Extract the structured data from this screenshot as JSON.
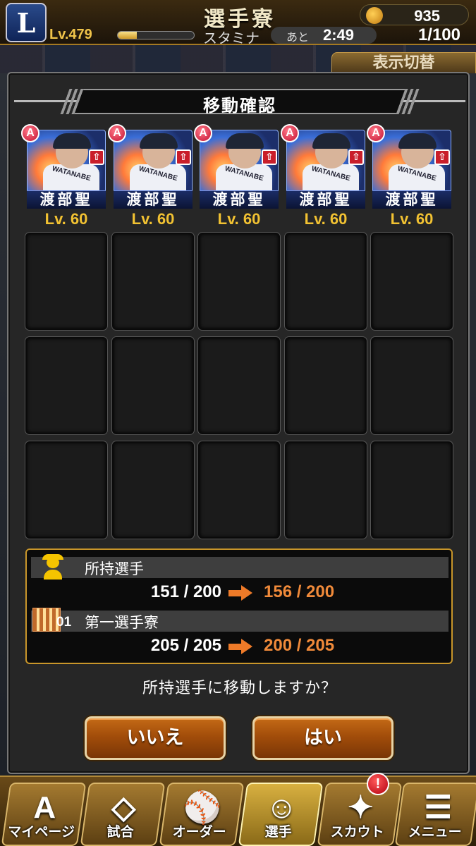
{
  "header": {
    "team_logo": "L",
    "screen_title": "選手寮",
    "coin_count": "935",
    "level": "Lv.479",
    "stamina_label": "スタミナ",
    "stamina_fraction": 0.25,
    "time_prefix": "あと",
    "time_value": "2:49",
    "count_value": "1/100",
    "display_toggle": "表示切替"
  },
  "modal": {
    "title": "移動確認",
    "cards": [
      {
        "rarity": "A",
        "name": "渡部聖",
        "level": "Lv. 60",
        "jersey": "WATANABE"
      },
      {
        "rarity": "A",
        "name": "渡部聖",
        "level": "Lv. 60",
        "jersey": "WATANABE"
      },
      {
        "rarity": "A",
        "name": "渡部聖",
        "level": "Lv. 60",
        "jersey": "WATANABE"
      },
      {
        "rarity": "A",
        "name": "渡部聖",
        "level": "Lv. 60",
        "jersey": "WATANABE"
      },
      {
        "rarity": "A",
        "name": "渡部聖",
        "level": "Lv. 60",
        "jersey": "WATANABE"
      }
    ],
    "owned": {
      "label": "所持選手",
      "current": "151 / 200",
      "next": "156 / 200"
    },
    "dorm": {
      "number": "01",
      "label": "第一選手寮",
      "current": "205 / 205",
      "next": "200 / 205"
    },
    "question": "所持選手に移動しますか？",
    "no_label": "いいえ",
    "yes_label": "はい"
  },
  "nav": {
    "items": [
      {
        "label": "マイページ",
        "glyph": "A"
      },
      {
        "label": "試合",
        "glyph": "◇"
      },
      {
        "label": "オーダー",
        "glyph": "⚾"
      },
      {
        "label": "選手",
        "glyph": "☺"
      },
      {
        "label": "スカウト",
        "glyph": "✦"
      },
      {
        "label": "メニュー",
        "glyph": "☰"
      }
    ],
    "notice_badge": "!"
  },
  "colors": {
    "accent_gold": "#c9962a",
    "button_orange": "#a24d0a",
    "next_value_orange": "#f08a3a",
    "level_yellow": "#f2c232"
  }
}
